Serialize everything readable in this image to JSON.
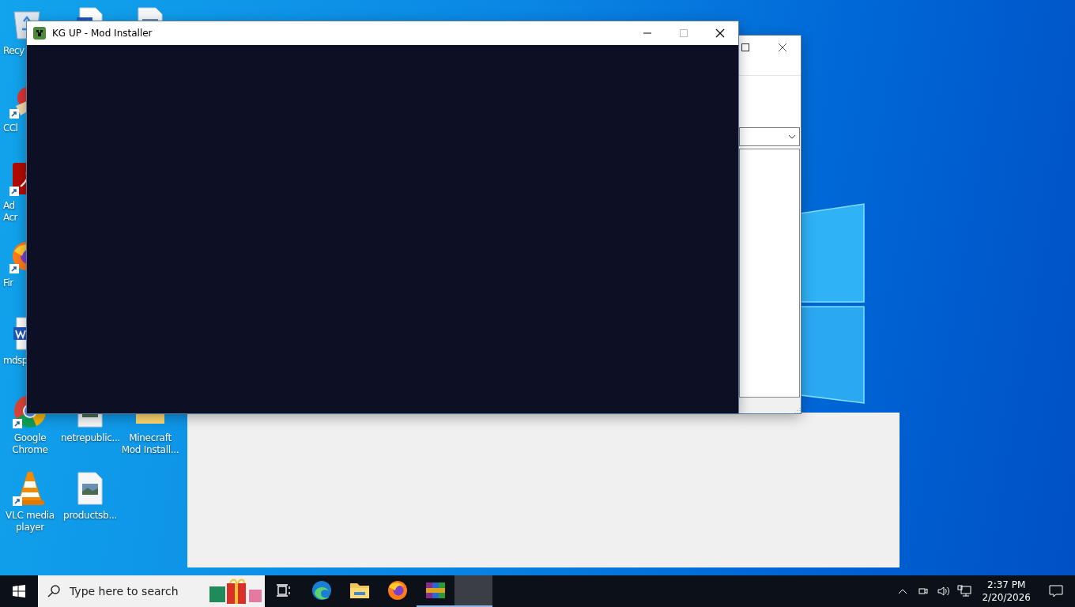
{
  "desktop_icons": [
    {
      "kind": "recycle",
      "label": "Recy",
      "cut": true,
      "shortcut": false
    },
    {
      "kind": "ccleaner",
      "label": "CCl",
      "cut": true,
      "shortcut": true
    },
    {
      "kind": "acrobat",
      "label": "Ad Acr",
      "cut": true,
      "shortcut": true
    },
    {
      "kind": "firefox",
      "label": "Fir",
      "cut": true,
      "shortcut": true
    },
    {
      "kind": "word",
      "label": "mdsp",
      "cut": true,
      "shortcut": false
    },
    {
      "kind": "chrome",
      "label": "Google Chrome",
      "cut": false,
      "shortcut": true
    },
    {
      "kind": "vlc",
      "label": "VLC media player",
      "cut": false,
      "shortcut": true
    },
    {
      "kind": "word"
    },
    {
      "kind": "image",
      "label": "netrepublic...",
      "cut": false,
      "shortcut": false
    },
    {
      "kind": "image",
      "label": "productsb...",
      "cut": false,
      "shortcut": false
    },
    {
      "kind": "image"
    },
    {
      "kind": "folder",
      "label": "Minecraft Mod Install...",
      "cut": false,
      "shortcut": false
    }
  ],
  "front_window": {
    "title": "KG UP - Mod Installer"
  },
  "taskbar": {
    "search": {
      "placeholder": "Type here to search"
    },
    "apps": [
      {
        "kind": "taskview",
        "running": false,
        "selected": false
      },
      {
        "kind": "edge",
        "running": false,
        "selected": false
      },
      {
        "kind": "explorer",
        "running": false,
        "selected": false
      },
      {
        "kind": "firefox",
        "running": false,
        "selected": false
      },
      {
        "kind": "winrar",
        "running": true,
        "selected": false
      },
      {
        "kind": "blank",
        "running": true,
        "selected": true
      }
    ],
    "clock": {
      "time": "2:37 PM",
      "date": "2/20/2026"
    }
  }
}
